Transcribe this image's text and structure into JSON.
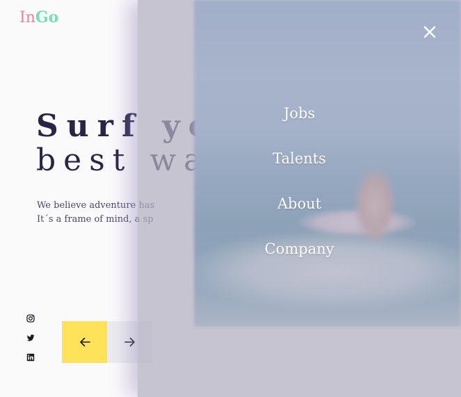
{
  "brand": {
    "part1": "In",
    "part2": "Go",
    "color1": "#ef7f94",
    "color2": "#72e2b3"
  },
  "hero": {
    "title_line1": "Surf your",
    "title_line2": "best wave",
    "desc_line1": "We believe adventure has",
    "desc_line2": "It´s a frame of mind, a sp"
  },
  "social": [
    "instagram-icon",
    "twitter-icon",
    "linkedin-icon"
  ],
  "slider": {
    "prev_icon": "arrow-left-icon",
    "next_icon": "arrow-right-icon",
    "accent": "#fde25a"
  },
  "menu": {
    "items": [
      "Jobs",
      "Talents",
      "About",
      "Company"
    ],
    "close_icon": "close-icon"
  }
}
